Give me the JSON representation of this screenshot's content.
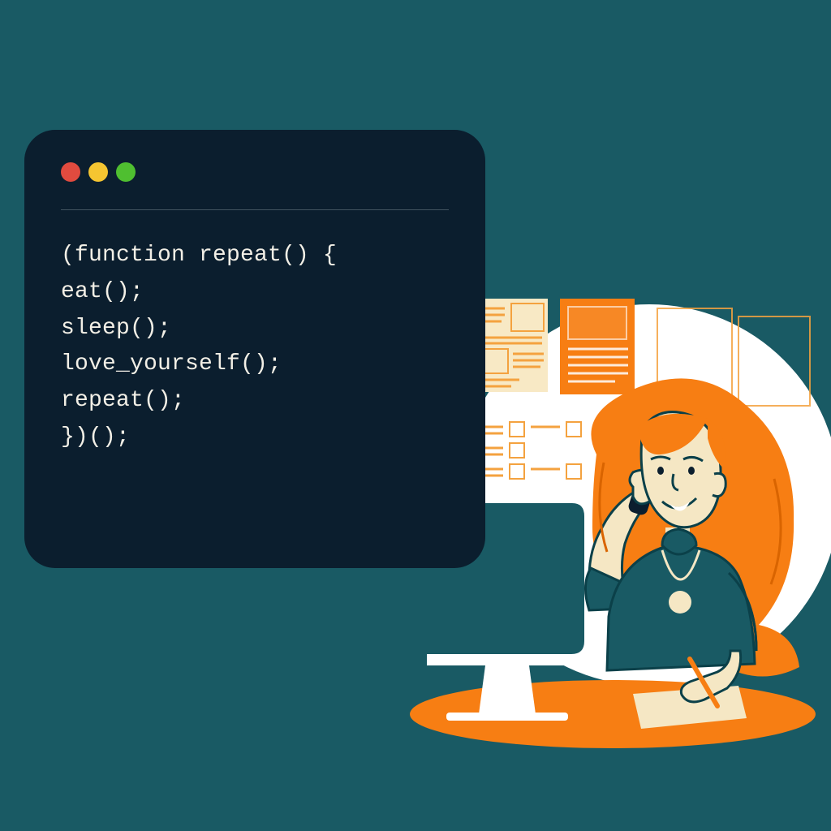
{
  "editor": {
    "traffic_colors": {
      "red": "#e14b3f",
      "yellow": "#f5c531",
      "green": "#4fbf30"
    },
    "code_lines": [
      "(function repeat() {",
      "eat();",
      "sleep();",
      "love_yourself();",
      "repeat();",
      "})();"
    ]
  },
  "illustration": {
    "description": "woman-with-orange-hair-on-phone-at-desk-with-computer",
    "accent_color": "#f77e13",
    "background_shape": "white-circle"
  },
  "page": {
    "background_color": "#195a64",
    "editor_background": "#0b1e2e"
  }
}
